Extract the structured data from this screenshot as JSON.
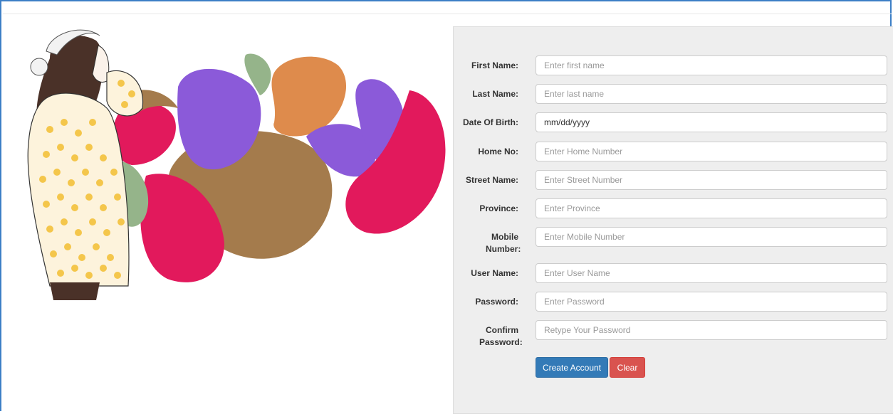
{
  "form": {
    "fields": [
      {
        "label": "First Name:",
        "placeholder": "Enter first name",
        "value": ""
      },
      {
        "label": "Last Name:",
        "placeholder": "Enter last name",
        "value": ""
      },
      {
        "label": "Date Of Birth:",
        "placeholder": "mm/dd/yyyy",
        "value": "mm/dd/yyyy"
      },
      {
        "label": "Home No:",
        "placeholder": "Enter Home Number",
        "value": ""
      },
      {
        "label": "Street Name:",
        "placeholder": "Enter Street Number",
        "value": ""
      },
      {
        "label": "Province:",
        "placeholder": "Enter Province",
        "value": ""
      },
      {
        "label": "Mobile Number:",
        "placeholder": "Enter Mobile Number",
        "value": ""
      },
      {
        "label": "User Name:",
        "placeholder": "Enter User Name",
        "value": ""
      },
      {
        "label": "Password:",
        "placeholder": "Enter Password",
        "value": ""
      },
      {
        "label": "Confirm Password:",
        "placeholder": "Retype Your Password",
        "value": ""
      }
    ],
    "create_label": "Create Account",
    "clear_label": "Clear"
  },
  "colors": {
    "primary": "#337ab7",
    "danger": "#d9534f",
    "panel_bg": "#eeeeee",
    "splash_purple": "#8b5ad9",
    "splash_pink": "#e2195c",
    "splash_brown": "#a47b4c",
    "splash_orange": "#de8b4c",
    "splash_green": "#95b48a"
  },
  "illustration": {
    "icon": "woman-with-paint-splash-illustration"
  }
}
